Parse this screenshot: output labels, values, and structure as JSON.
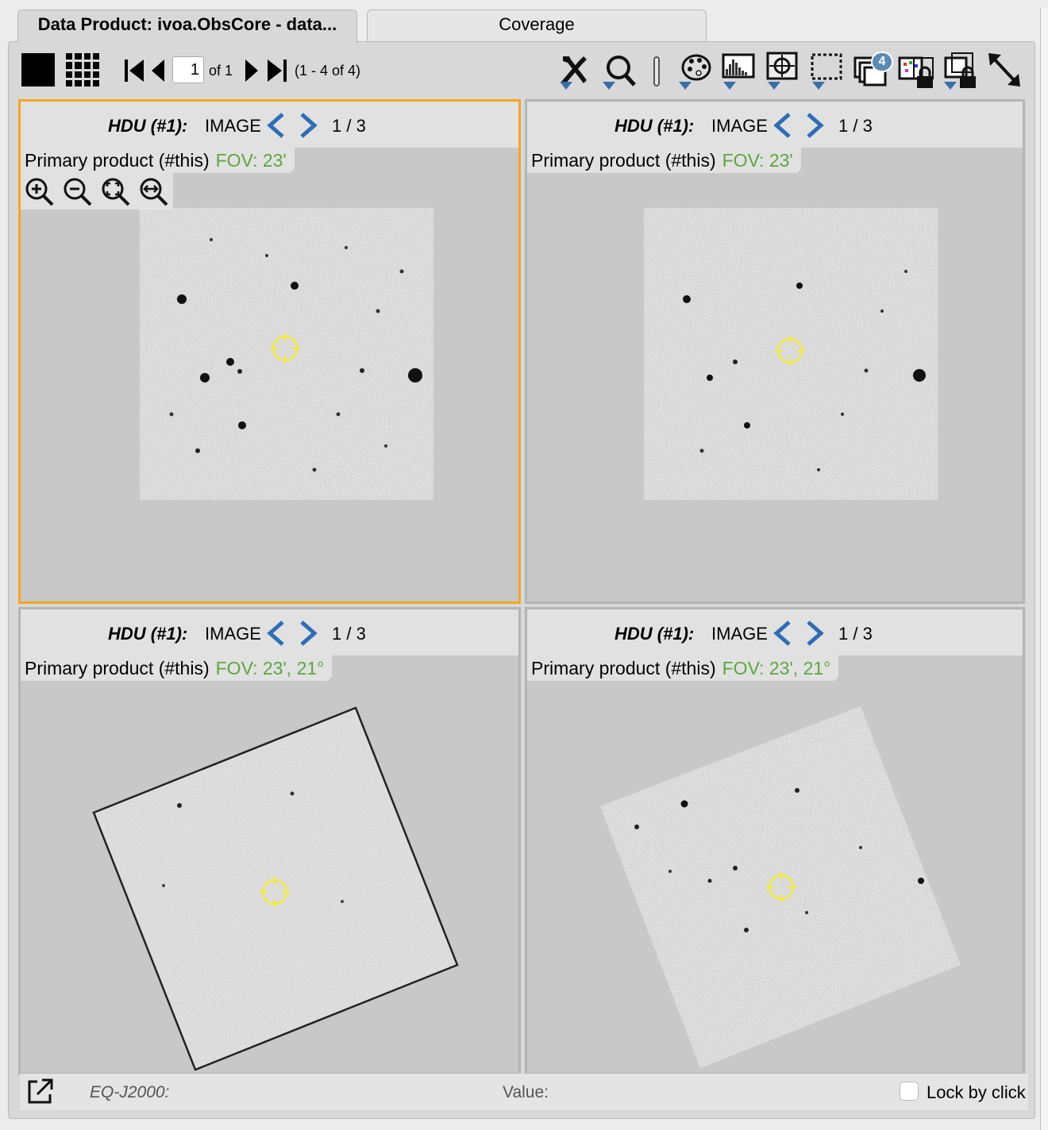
{
  "tabs": [
    {
      "label": "Data Product: ivoa.ObsCore - data..."
    },
    {
      "label": "Coverage"
    }
  ],
  "toolbar": {
    "page_value": "1",
    "page_of": "of 1",
    "range": "(1 - 4 of 4)",
    "layer_count": "4",
    "icons": [
      "view-single-icon",
      "view-grid-icon",
      "first-page-icon",
      "prev-page-icon",
      "next-page-icon",
      "last-page-icon",
      "tools-icon",
      "zoom-search-icon",
      "separator",
      "color-palette-icon",
      "stretch-histogram-icon",
      "center-target-icon",
      "select-area-icon",
      "layers-icon",
      "locked-lock-icon",
      "lock-settings-icon",
      "expand-icon"
    ]
  },
  "tiles": [
    {
      "hdu_label": "HDU (#1):",
      "hdu_type": "IMAGE",
      "hdu_count": "1 / 3",
      "product": "Primary product (#this)",
      "fov": "FOV: 23'",
      "selected": true
    },
    {
      "hdu_label": "HDU (#1):",
      "hdu_type": "IMAGE",
      "hdu_count": "1 / 3",
      "product": "Primary product (#this)",
      "fov": "FOV: 23'",
      "selected": false
    },
    {
      "hdu_label": "HDU (#1):",
      "hdu_type": "IMAGE",
      "hdu_count": "1 / 3",
      "product": "Primary product (#this)",
      "fov": "FOV: 23',  21°",
      "selected": false
    },
    {
      "hdu_label": "HDU (#1):",
      "hdu_type": "IMAGE",
      "hdu_count": "1 / 3",
      "product": "Primary product (#this)",
      "fov": "FOV: 23',  21°",
      "selected": false
    }
  ],
  "status": {
    "coord_label": "EQ-J2000:",
    "value_label": "Value:",
    "lock_label": "Lock by click",
    "lock_checked": false
  },
  "colors": {
    "accent_selected": "#f5a623",
    "fov_green": "#5ca640",
    "nav_arrow_blue": "#2f6db5",
    "target_yellow": "#f2ea3a",
    "dropdown_blue": "#3a6ea5"
  }
}
